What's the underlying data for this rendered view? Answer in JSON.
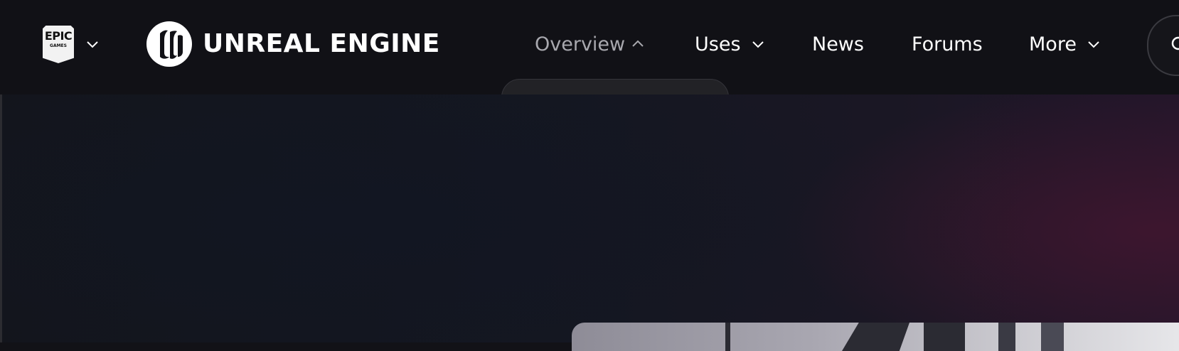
{
  "header": {
    "epic_logo": {
      "line1": "EPIC",
      "line2": "GAMES"
    },
    "brand": {
      "name": "UNREAL ENGINE"
    },
    "nav": [
      {
        "label": "Overview",
        "icon": "chevron-up-icon",
        "state": "expanded"
      },
      {
        "label": "Uses",
        "icon": "chevron-down-icon"
      },
      {
        "label": "News"
      },
      {
        "label": "Forums"
      },
      {
        "label": "More",
        "icon": "chevron-down-icon"
      }
    ],
    "search_icon": "search-icon"
  },
  "colors": {
    "nav_background": "#111116",
    "active_nav_text": "#a8a8ae",
    "text": "#ffffff",
    "hero_accent": "#46162f"
  }
}
